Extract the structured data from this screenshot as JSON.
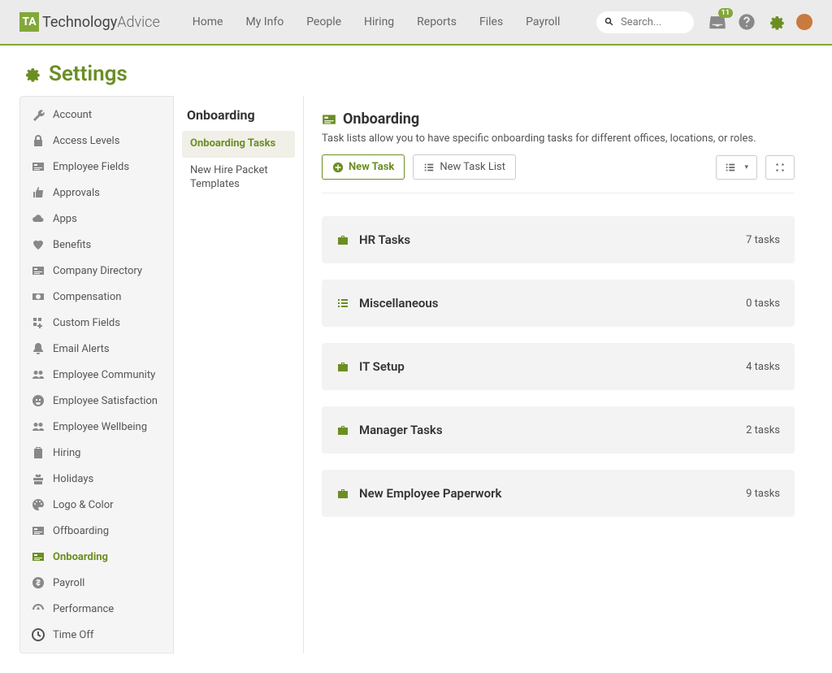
{
  "brand": {
    "mark": "TA",
    "name_strong": "Technology",
    "name_light": "Advice"
  },
  "topnav": [
    "Home",
    "My Info",
    "People",
    "Hiring",
    "Reports",
    "Files",
    "Payroll"
  ],
  "search": {
    "placeholder": "Search..."
  },
  "notifications": {
    "count": "11"
  },
  "page_title": "Settings",
  "sidebar": [
    {
      "label": "Account",
      "icon": "wrench"
    },
    {
      "label": "Access Levels",
      "icon": "lock"
    },
    {
      "label": "Employee Fields",
      "icon": "id-card"
    },
    {
      "label": "Approvals",
      "icon": "thumb-up"
    },
    {
      "label": "Apps",
      "icon": "cloud"
    },
    {
      "label": "Benefits",
      "icon": "heart"
    },
    {
      "label": "Company Directory",
      "icon": "id-card"
    },
    {
      "label": "Compensation",
      "icon": "money"
    },
    {
      "label": "Custom Fields",
      "icon": "grid-plus"
    },
    {
      "label": "Email Alerts",
      "icon": "bell"
    },
    {
      "label": "Employee Community",
      "icon": "group"
    },
    {
      "label": "Employee Satisfaction",
      "icon": "smiley"
    },
    {
      "label": "Employee Wellbeing",
      "icon": "group"
    },
    {
      "label": "Hiring",
      "icon": "clipboard"
    },
    {
      "label": "Holidays",
      "icon": "gift"
    },
    {
      "label": "Logo & Color",
      "icon": "palette"
    },
    {
      "label": "Offboarding",
      "icon": "id-card"
    },
    {
      "label": "Onboarding",
      "icon": "id-card",
      "active": true
    },
    {
      "label": "Payroll",
      "icon": "dollar"
    },
    {
      "label": "Performance",
      "icon": "gauge"
    },
    {
      "label": "Time Off",
      "icon": "clock"
    }
  ],
  "subnav": {
    "title": "Onboarding",
    "items": [
      {
        "label": "Onboarding Tasks",
        "active": true
      },
      {
        "label": "New Hire Packet Templates"
      }
    ]
  },
  "main": {
    "heading": "Onboarding",
    "description": "Task lists allow you to have specific onboarding tasks for different offices, locations, or roles.",
    "new_task_label": "New Task",
    "new_task_list_label": "New Task List",
    "task_lists": [
      {
        "title": "HR Tasks",
        "count": "7 tasks",
        "icon": "briefcase"
      },
      {
        "title": "Miscellaneous",
        "count": "0 tasks",
        "icon": "list"
      },
      {
        "title": "IT Setup",
        "count": "4 tasks",
        "icon": "briefcase"
      },
      {
        "title": "Manager Tasks",
        "count": "2 tasks",
        "icon": "briefcase"
      },
      {
        "title": "New Employee Paperwork",
        "count": "9 tasks",
        "icon": "briefcase"
      }
    ]
  }
}
